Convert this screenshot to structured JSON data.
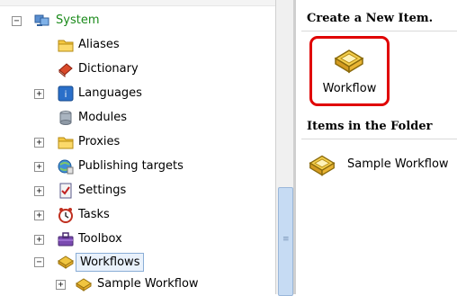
{
  "tree": {
    "items": [
      {
        "label": "System",
        "icon": "system-icon",
        "expander": "−",
        "color": "#1a8a1a"
      },
      {
        "label": "Aliases",
        "icon": "folder-icon",
        "expander": ""
      },
      {
        "label": "Dictionary",
        "icon": "dictionary-icon",
        "expander": ""
      },
      {
        "label": "Languages",
        "icon": "languages-icon",
        "expander": "+"
      },
      {
        "label": "Modules",
        "icon": "modules-icon",
        "expander": ""
      },
      {
        "label": "Proxies",
        "icon": "folder-icon",
        "expander": "+"
      },
      {
        "label": "Publishing targets",
        "icon": "publishing-targets-icon",
        "expander": "+"
      },
      {
        "label": "Settings",
        "icon": "settings-icon",
        "expander": "+"
      },
      {
        "label": "Tasks",
        "icon": "tasks-icon",
        "expander": "+"
      },
      {
        "label": "Toolbox",
        "icon": "toolbox-icon",
        "expander": "+"
      },
      {
        "label": "Workflows",
        "icon": "workflow-icon",
        "expander": "−",
        "selected": true
      },
      {
        "label": "Sample Workflow",
        "icon": "workflow-icon",
        "expander": "+"
      }
    ]
  },
  "panel": {
    "create_header": "Create a New Item.",
    "workflow_button_label": "Workflow",
    "folder_header": "Items in the Folder",
    "folder_item_label": "Sample Workflow"
  },
  "colors": {
    "selected_border": "#8aaed6",
    "selected_bg": "#e9f1fb",
    "highlight_red": "#e00000"
  }
}
